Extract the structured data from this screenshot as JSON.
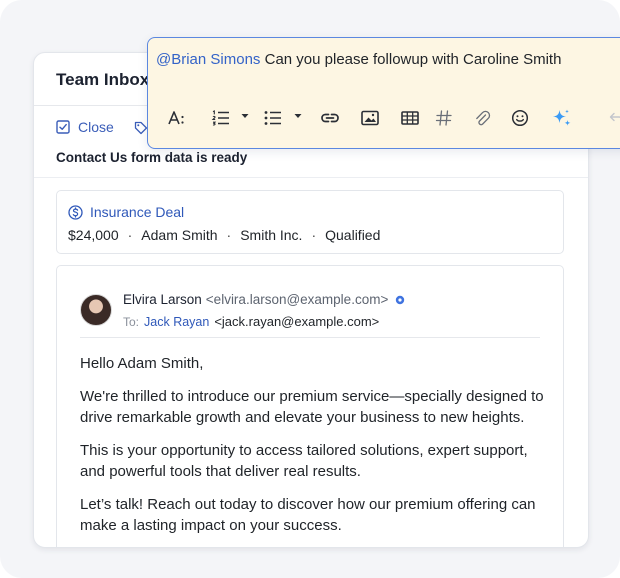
{
  "card": {
    "title": "Team Inbox",
    "close_label": "Close",
    "subject": "Contact Us form data is ready"
  },
  "deal": {
    "title": "Insurance Deal",
    "amount": "$24,000",
    "contact": "Adam Smith",
    "company": "Smith Inc.",
    "stage": "Qualified",
    "separator": "·"
  },
  "email": {
    "sender_name": "Elvira Larson",
    "sender_address": "<elvira.larson@example.com>",
    "to_label": "To:",
    "to_name": "Jack Rayan",
    "to_address": "<jack.rayan@example.com>",
    "greeting": "Hello Adam Smith,",
    "para1": "We're thrilled to introduce our premium service—specially designed to drive remarkable growth and elevate your business to new heights.",
    "para2": "This is your opportunity to access tailored solutions, expert support, and powerful tools that deliver real results.",
    "para3": "Let’s talk! Reach out today to discover how our premium offering can make a lasting impact on your success."
  },
  "composer": {
    "mention": "@Brian Simons",
    "text": "Can you please followup with Caroline Smith"
  },
  "colors": {
    "accent": "#3463c8",
    "composer_bg": "#fdf6e3",
    "composer_border": "#5b87e0",
    "ai_sparkle": "#3b9bf5"
  },
  "icons": {
    "close": "checkbox-icon",
    "tag": "tag-icon",
    "deal": "dollar-circle-icon",
    "verified": "verified-dot-icon",
    "toolbar": [
      "text-size-icon",
      "ordered-list-icon",
      "bullet-list-icon",
      "link-icon",
      "image-icon",
      "table-icon",
      "hashtag-icon",
      "attachment-icon",
      "emoji-icon",
      "ai-sparkle-icon",
      "undo-icon"
    ]
  }
}
